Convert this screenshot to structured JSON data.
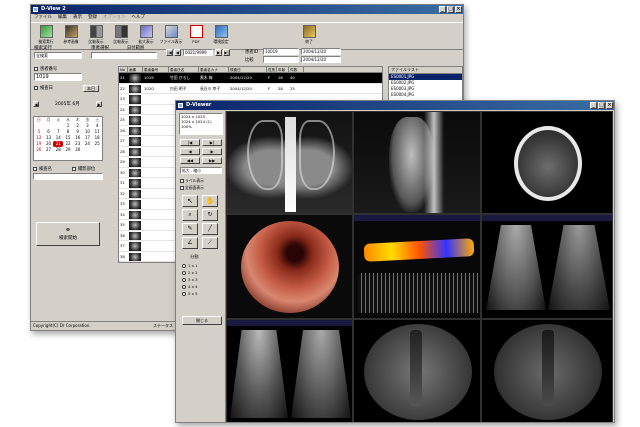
{
  "main_window": {
    "title": "D-View 2",
    "menu": [
      "ファイル",
      "編集",
      "表示",
      "登録",
      "オプション",
      "ヘルプ"
    ],
    "toolbar": [
      {
        "label": "検索実行",
        "icon": "search-icon"
      },
      {
        "label": "参考画像",
        "icon": "reference-image-icon"
      },
      {
        "label": "比較表示",
        "icon": "compare-icon"
      },
      {
        "label": "比較表示",
        "icon": "compare2-icon"
      },
      {
        "label": "拡大表示",
        "icon": "zoom-icon"
      },
      {
        "label": "ファイル表示",
        "icon": "file-view-icon"
      },
      {
        "label": "PDF",
        "icon": "pdf-icon"
      },
      {
        "label": "環境設定",
        "icon": "settings-icon"
      },
      {
        "label": "終了",
        "icon": "exit-icon"
      }
    ],
    "search_header": "検索実行",
    "patient_select": "患者選択",
    "dropdown_value": "全検索",
    "date_label": "日付範囲",
    "range_text": "0021/9999",
    "patient_id_label": "患者ID",
    "patient_id_value": "10019",
    "date_value": "2004/12/20",
    "date_value2": "2004/12/20",
    "compare_label": "比較",
    "check_patient_no": "患者番号",
    "patient_no_value": "1019",
    "check_exam_date": "検査日",
    "today_btn": "本日",
    "calendar_month": "2005年 6月",
    "calendar_weekdays": [
      "日",
      "月",
      "火",
      "水",
      "木",
      "金",
      "土"
    ],
    "calendar_days": [
      "",
      "",
      "",
      "1",
      "2",
      "3",
      "4",
      "5",
      "6",
      "7",
      "8",
      "9",
      "10",
      "11",
      "12",
      "13",
      "14",
      "15",
      "16",
      "17",
      "18",
      "19",
      "20",
      "21",
      "22",
      "23",
      "24",
      "25",
      "26",
      "27",
      "28",
      "29",
      "30",
      "",
      ""
    ],
    "calendar_selected": "21",
    "check_exam_name": "検査名",
    "check_part": "撮影部位",
    "search_button": "検索開始",
    "table_headers": [
      "No",
      "画像",
      "患者番号",
      "患者氏名",
      "患者名カナ",
      "検査日",
      "性別",
      "年齢",
      "件数"
    ],
    "rows": [
      {
        "no": "21",
        "id": "1019",
        "name": "竹田 ひろし",
        "name2": "黒木 梅",
        "date": "2004/12/20",
        "sex": "F",
        "age": "16",
        "count": "40",
        "hl": true
      },
      {
        "no": "22",
        "id": "1020",
        "name": "内田 明子",
        "name2": "長谷川 幸子",
        "date": "2004/12/20",
        "sex": "F",
        "age": "28",
        "count": "25",
        "hl": false
      },
      {
        "no": "23",
        "id": "",
        "name": "",
        "name2": "",
        "date": "",
        "sex": "",
        "age": "",
        "count": "",
        "hl": false
      },
      {
        "no": "24",
        "id": "",
        "name": "",
        "name2": "",
        "date": "",
        "sex": "",
        "age": "",
        "count": "",
        "hl": false
      },
      {
        "no": "25",
        "id": "",
        "name": "",
        "name2": "",
        "date": "",
        "sex": "",
        "age": "",
        "count": "",
        "hl": false
      },
      {
        "no": "26",
        "id": "",
        "name": "",
        "name2": "",
        "date": "",
        "sex": "",
        "age": "",
        "count": "",
        "hl": false
      },
      {
        "no": "27",
        "id": "",
        "name": "",
        "name2": "",
        "date": "",
        "sex": "",
        "age": "",
        "count": "",
        "hl": false
      },
      {
        "no": "28",
        "id": "",
        "name": "",
        "name2": "",
        "date": "",
        "sex": "",
        "age": "",
        "count": "",
        "hl": false
      },
      {
        "no": "29",
        "id": "",
        "name": "",
        "name2": "",
        "date": "",
        "sex": "",
        "age": "",
        "count": "",
        "hl": false
      },
      {
        "no": "30",
        "id": "",
        "name": "",
        "name2": "",
        "date": "",
        "sex": "",
        "age": "",
        "count": "",
        "hl": false
      },
      {
        "no": "31",
        "id": "",
        "name": "",
        "name2": "",
        "date": "",
        "sex": "",
        "age": "",
        "count": "",
        "hl": false
      },
      {
        "no": "32",
        "id": "",
        "name": "",
        "name2": "",
        "date": "",
        "sex": "",
        "age": "",
        "count": "",
        "hl": false
      },
      {
        "no": "33",
        "id": "",
        "name": "",
        "name2": "",
        "date": "",
        "sex": "",
        "age": "",
        "count": "",
        "hl": false
      },
      {
        "no": "34",
        "id": "",
        "name": "",
        "name2": "",
        "date": "",
        "sex": "",
        "age": "",
        "count": "",
        "hl": false
      },
      {
        "no": "35",
        "id": "",
        "name": "",
        "name2": "",
        "date": "",
        "sex": "",
        "age": "",
        "count": "",
        "hl": false
      },
      {
        "no": "36",
        "id": "",
        "name": "",
        "name2": "",
        "date": "",
        "sex": "",
        "age": "",
        "count": "",
        "hl": false
      },
      {
        "no": "37",
        "id": "",
        "name": "",
        "name2": "",
        "date": "",
        "sex": "",
        "age": "",
        "count": "",
        "hl": false
      },
      {
        "no": "38",
        "id": "",
        "name": "",
        "name2": "",
        "date": "",
        "sex": "",
        "age": "",
        "count": "",
        "hl": false
      }
    ],
    "file_list_header": "ファイルリスト",
    "files": [
      "ES0001.JPG",
      "ES0002.JPG",
      "ES0003.JPG",
      "ES0004.JPG"
    ],
    "status_left": "Copyright(C) Dr Corporation.",
    "status_right": "ステータス"
  },
  "viewer_window": {
    "title": "D-Viewer",
    "zoom_info_1": "1024 x 1025",
    "zoom_info_2": "1024 x 1024 (1)",
    "zoom_info_3": "100%",
    "zoom_dropdown": "拡大 - 縮小",
    "check_label_show": "ラベル表示",
    "check_fullscreen": "全画面表示",
    "layout_label": "分割",
    "layout_options": [
      "1 x 1",
      "2 x 2",
      "3 x 3",
      "4 x 4",
      "5 x 5"
    ],
    "close_button": "閉じる"
  }
}
